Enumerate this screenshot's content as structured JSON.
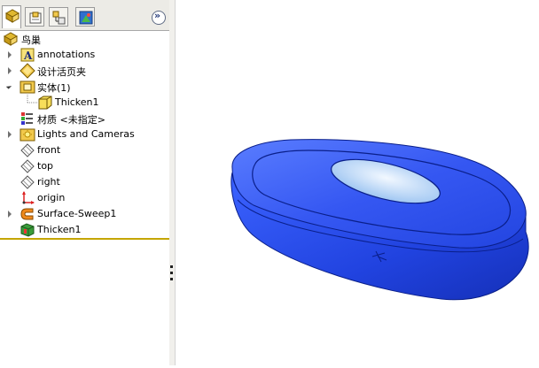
{
  "tabs": [
    {
      "name": "FeatureManager",
      "icon": "feature-tree-icon"
    },
    {
      "name": "PropertyManager",
      "icon": "property-manager-icon"
    },
    {
      "name": "ConfigurationManager",
      "icon": "configuration-manager-icon"
    },
    {
      "name": "DisplayManager",
      "icon": "display-manager-icon"
    }
  ],
  "collapse_glyph": "»",
  "tree": {
    "part_name": "鸟巢",
    "items": [
      {
        "label": "annotations",
        "icon": "annotations-icon"
      },
      {
        "label": "设计活页夹",
        "icon": "design-binder-icon"
      },
      {
        "label": "实体(1)",
        "icon": "solid-bodies-folder-icon"
      },
      {
        "label": "Thicken1",
        "icon": "solid-body-icon"
      },
      {
        "label": "材质 <未指定>",
        "icon": "material-icon"
      },
      {
        "label": "Lights and Cameras",
        "icon": "lights-cameras-icon"
      },
      {
        "label": "front",
        "icon": "plane-icon"
      },
      {
        "label": "top",
        "icon": "plane-icon"
      },
      {
        "label": "right",
        "icon": "plane-icon"
      },
      {
        "label": "origin",
        "icon": "origin-icon"
      },
      {
        "label": "Surface-Sweep1",
        "icon": "surface-sweep-icon"
      },
      {
        "label": "Thicken1",
        "icon": "thicken-feature-icon"
      }
    ]
  },
  "colors": {
    "model_fill": "#2b4fe8",
    "model_highlight": "#6f8cff",
    "model_edge": "#0a1f8a",
    "hole_inner": "#d9ecff",
    "selection_rule": "#c5a600"
  }
}
